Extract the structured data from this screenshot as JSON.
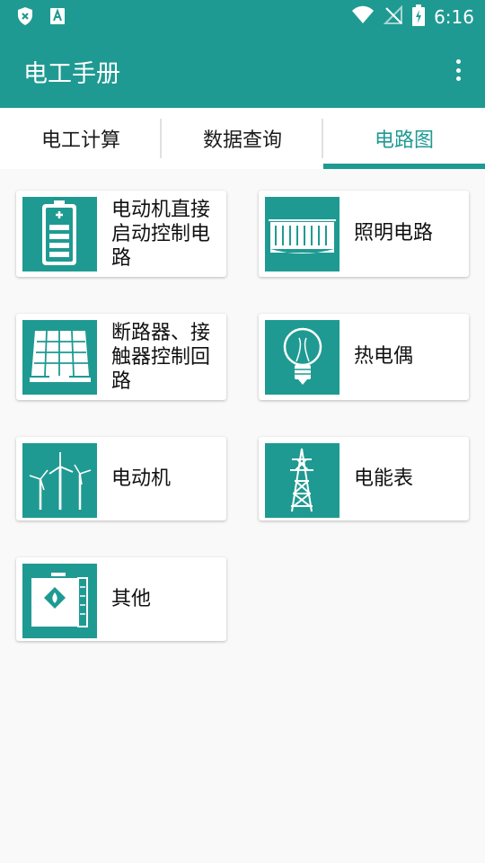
{
  "status_bar": {
    "time": "6:16",
    "icons": [
      "shield-x-icon",
      "font-a-icon",
      "wifi-icon",
      "signal-off-icon",
      "battery-charging-icon"
    ]
  },
  "app_bar": {
    "title": "电工手册",
    "menu_icon": "more-vert-icon"
  },
  "tabs": [
    {
      "label": "电工计算",
      "active": false
    },
    {
      "label": "数据查询",
      "active": false
    },
    {
      "label": "电路图",
      "active": true
    }
  ],
  "cards": [
    {
      "label": "电动机直接启动控制电路",
      "icon": "battery-icon"
    },
    {
      "label": "照明电路",
      "icon": "power-station-icon"
    },
    {
      "label": "断路器、接触器控制回路",
      "icon": "solar-panel-icon"
    },
    {
      "label": "热电偶",
      "icon": "light-bulb-icon"
    },
    {
      "label": "电动机",
      "icon": "wind-turbine-icon"
    },
    {
      "label": "电能表",
      "icon": "power-tower-icon"
    },
    {
      "label": "其他",
      "icon": "flammable-container-icon"
    }
  ],
  "colors": {
    "primary": "#1f9a92",
    "background": "#f9f9f9",
    "card": "#ffffff",
    "text": "#111111"
  }
}
